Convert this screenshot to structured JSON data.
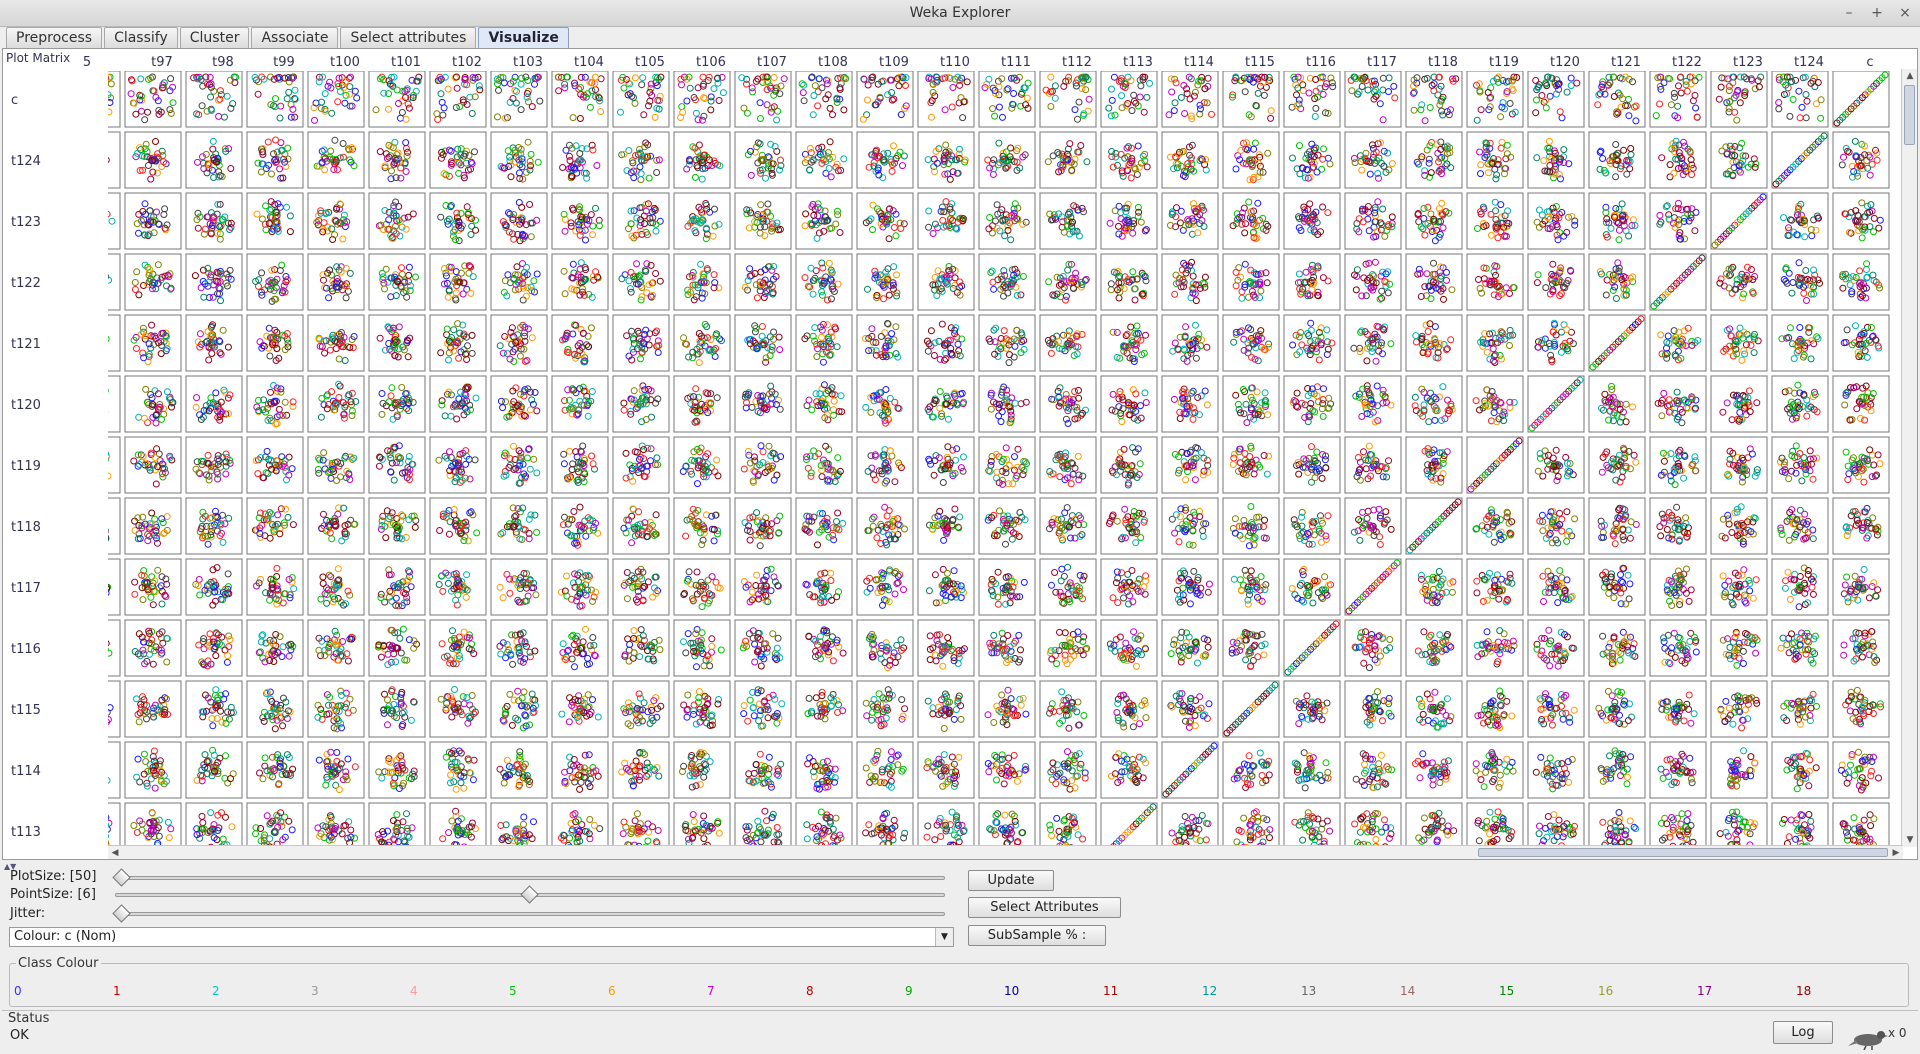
{
  "window": {
    "title": "Weka Explorer",
    "controls": [
      "–",
      "+",
      "×"
    ]
  },
  "tabs": [
    {
      "label": "Preprocess",
      "active": false
    },
    {
      "label": "Classify",
      "active": false
    },
    {
      "label": "Cluster",
      "active": false
    },
    {
      "label": "Associate",
      "active": false
    },
    {
      "label": "Select attributes",
      "active": false
    },
    {
      "label": "Visualize",
      "active": true
    }
  ],
  "matrix": {
    "header_label": "Plot Matrix",
    "partial_column_label": "5",
    "columns": [
      "t97",
      "t98",
      "t99",
      "t100",
      "t101",
      "t102",
      "t103",
      "t104",
      "t105",
      "t106",
      "t107",
      "t108",
      "t109",
      "t110",
      "t111",
      "t112",
      "t113",
      "t114",
      "t115",
      "t116",
      "t117",
      "t118",
      "t119",
      "t120",
      "t121",
      "t122",
      "t123",
      "t124",
      "c"
    ],
    "rows": [
      "c",
      "t124",
      "t123",
      "t122",
      "t121",
      "t120",
      "t119",
      "t118",
      "t117",
      "t116",
      "t115",
      "t114",
      "t113"
    ],
    "point_colors": [
      "#a00030",
      "#800000",
      "#c000c0",
      "#1a1aff",
      "#00c000",
      "#ff2020",
      "#00b0b0",
      "#808000",
      "#008060",
      "#ff9900",
      "#404040"
    ]
  },
  "controls": {
    "plot_size_label": "PlotSize: [50]",
    "point_size_label": "PointSize: [6]",
    "jitter_label": "Jitter:",
    "plot_size_value": 0,
    "point_size_value": 0.5,
    "jitter_value": 0,
    "update_label": "Update",
    "select_attributes_label": "Select Attributes",
    "subsample_label": "SubSample % :",
    "colour_select": "Colour: c (Nom)"
  },
  "class_colour": {
    "title": "Class Colour",
    "values": [
      {
        "label": "0",
        "color": "#3333ff"
      },
      {
        "label": "1",
        "color": "#cc0000"
      },
      {
        "label": "2",
        "color": "#00cccc"
      },
      {
        "label": "3",
        "color": "#999999"
      },
      {
        "label": "4",
        "color": "#ff9999"
      },
      {
        "label": "5",
        "color": "#00cc00"
      },
      {
        "label": "6",
        "color": "#ff9900"
      },
      {
        "label": "7",
        "color": "#cc00cc"
      },
      {
        "label": "8",
        "color": "#cc0000"
      },
      {
        "label": "9",
        "color": "#00aa00"
      },
      {
        "label": "10",
        "color": "#000099"
      },
      {
        "label": "11",
        "color": "#990000"
      },
      {
        "label": "12",
        "color": "#009999"
      },
      {
        "label": "13",
        "color": "#666666"
      },
      {
        "label": "14",
        "color": "#996666"
      },
      {
        "label": "15",
        "color": "#008800"
      },
      {
        "label": "16",
        "color": "#999933"
      },
      {
        "label": "17",
        "color": "#880088"
      },
      {
        "label": "18",
        "color": "#990000"
      }
    ]
  },
  "status": {
    "title": "Status",
    "text": "OK",
    "log_label": "Log",
    "count": "x 0"
  }
}
